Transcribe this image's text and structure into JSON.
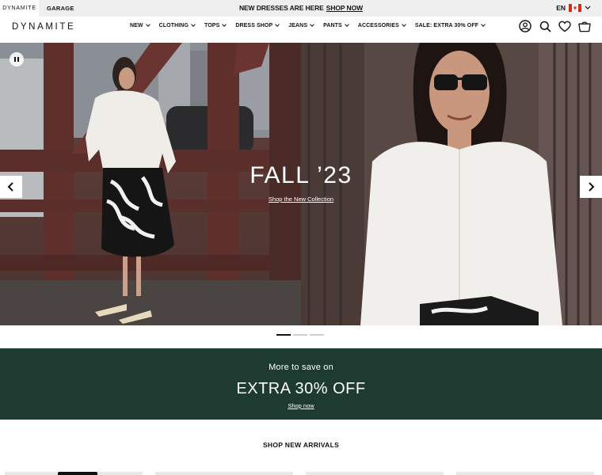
{
  "topbar": {
    "brands": [
      "DYNAMITE",
      "GARAGE"
    ],
    "promo_text": "NEW DRESSES ARE HERE",
    "promo_link": "SHOP NOW",
    "language": "EN",
    "flag_colors": [
      "#d52b1e",
      "#ffffff",
      "#d52b1e"
    ]
  },
  "header": {
    "logo": "DYNAMITE",
    "nav": [
      {
        "label": "NEW"
      },
      {
        "label": "CLOTHING"
      },
      {
        "label": "TOPS"
      },
      {
        "label": "DRESS SHOP"
      },
      {
        "label": "JEANS"
      },
      {
        "label": "PANTS"
      },
      {
        "label": "ACCESSORIES"
      },
      {
        "label": "SALE: EXTRA 30% OFF"
      }
    ],
    "icons": [
      "account-icon",
      "search-icon",
      "heart-icon",
      "bag-icon"
    ]
  },
  "hero": {
    "title": "FALL ’23",
    "subtitle": "Shop the New Collection",
    "slide_count": 3,
    "active_slide": 1
  },
  "promo_band": {
    "line1": "More to save on",
    "line2": "EXTRA 30% OFF",
    "link": "Shop now",
    "background": "#1e3b32"
  },
  "arrivals": {
    "heading": "SHOP NEW ARRIVALS"
  }
}
